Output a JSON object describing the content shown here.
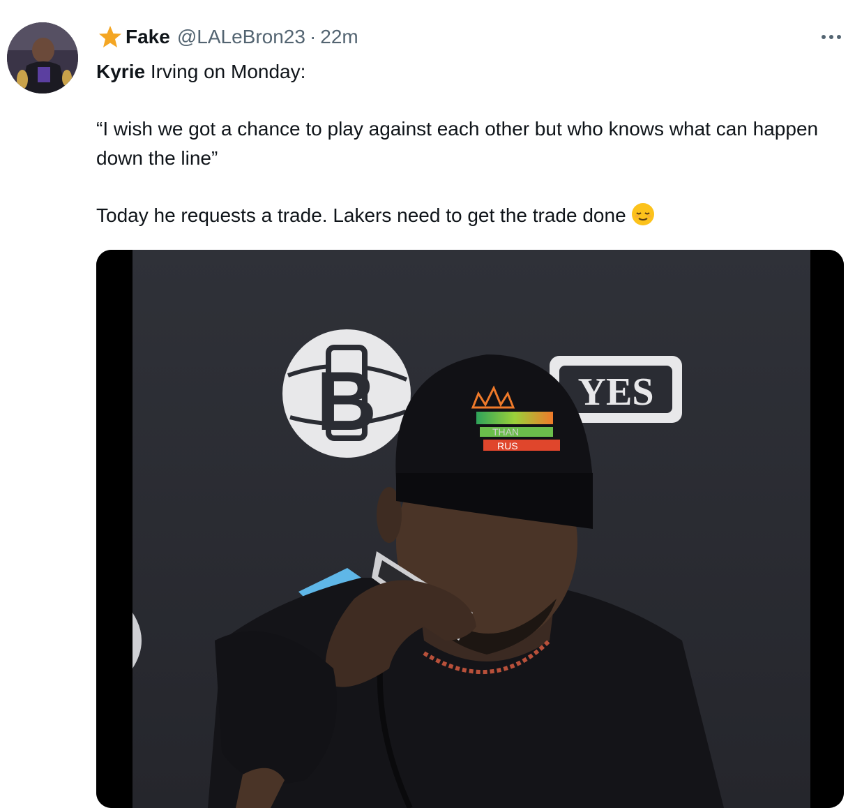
{
  "tweet": {
    "author_name": "Fake",
    "handle": "@LALeBron23",
    "separator": "·",
    "timestamp": "22m",
    "text_line1_bold": "Kyrie",
    "text_line1_rest": " Irving on Monday:",
    "quote": "“I wish we got a chance to play against each other but who knows what can happen down the line”",
    "text_line3": "Today he requests a trade. Lakers need to get the trade done"
  },
  "media": {
    "backdrop_logo_letter": "B",
    "backdrop_sponsor_text": "YES",
    "cap_text_top": "THAN",
    "cap_text_bottom": "RUS"
  },
  "icons": {
    "badge": "star-icon",
    "menu": "more-options-icon",
    "emoji": "relieved-face-emoji"
  },
  "colors": {
    "name_text": "#0f1419",
    "secondary_text": "#536471",
    "star": "#f4a623",
    "backdrop": "#2a2c33"
  }
}
